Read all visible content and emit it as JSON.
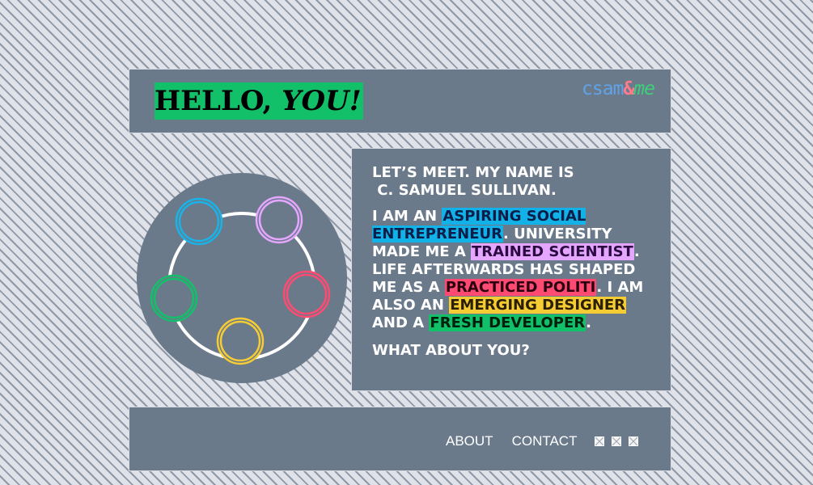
{
  "header": {
    "greeting_hello": "HELLO,",
    "greeting_you": "YOU!",
    "logo": {
      "part1": "csam",
      "part2": "&",
      "part3": "me",
      "colors": {
        "part1": "#5fa3e8",
        "part2": "#ff7a8a",
        "part3": "#3dd07a"
      }
    }
  },
  "intro": {
    "meet_line1": "LET’S MEET. MY NAME IS",
    "meet_line2": "C. SAMUEL SULLIVAN.",
    "bio": {
      "t1": "I AM AN ",
      "h1": "ASPIRING SOCIAL ENTREPRENEUR",
      "t2": ". UNIVERSITY MADE ME A ",
      "h2": "TRAINED SCIENTIST",
      "t3": ". LIFE AFTERWARDS HAS SHAPED ME AS A ",
      "h3": "PRACTICED POLITI",
      "t4": ". I AM ALSO AN ",
      "h4": "EMERGING DESIGNER",
      "t5": " AND A ",
      "h5": "FRESH DEVELOPER",
      "t6": "."
    },
    "question": "WHAT ABOUT YOU?"
  },
  "rings": [
    {
      "color": "#19b3e8",
      "role": "entrepreneur"
    },
    {
      "color": "#e5a6ff",
      "role": "scientist"
    },
    {
      "color": "#ff4a72",
      "role": "politician"
    },
    {
      "color": "#f6cc35",
      "role": "designer"
    },
    {
      "color": "#12c06a",
      "role": "developer"
    }
  ],
  "footer": {
    "nav": {
      "about": "ABOUT",
      "contact": "CONTACT"
    },
    "social_icons": [
      "broken-image-icon",
      "broken-image-icon",
      "broken-image-icon"
    ]
  },
  "colors": {
    "panel": "#6b7a8b",
    "background": "#dfe2e8",
    "highlight_green": "#12c06a",
    "highlight_blue": "#12b2e8",
    "highlight_purple": "#e5a6ff",
    "highlight_red": "#ff4a72",
    "highlight_yellow": "#f6cc35"
  }
}
